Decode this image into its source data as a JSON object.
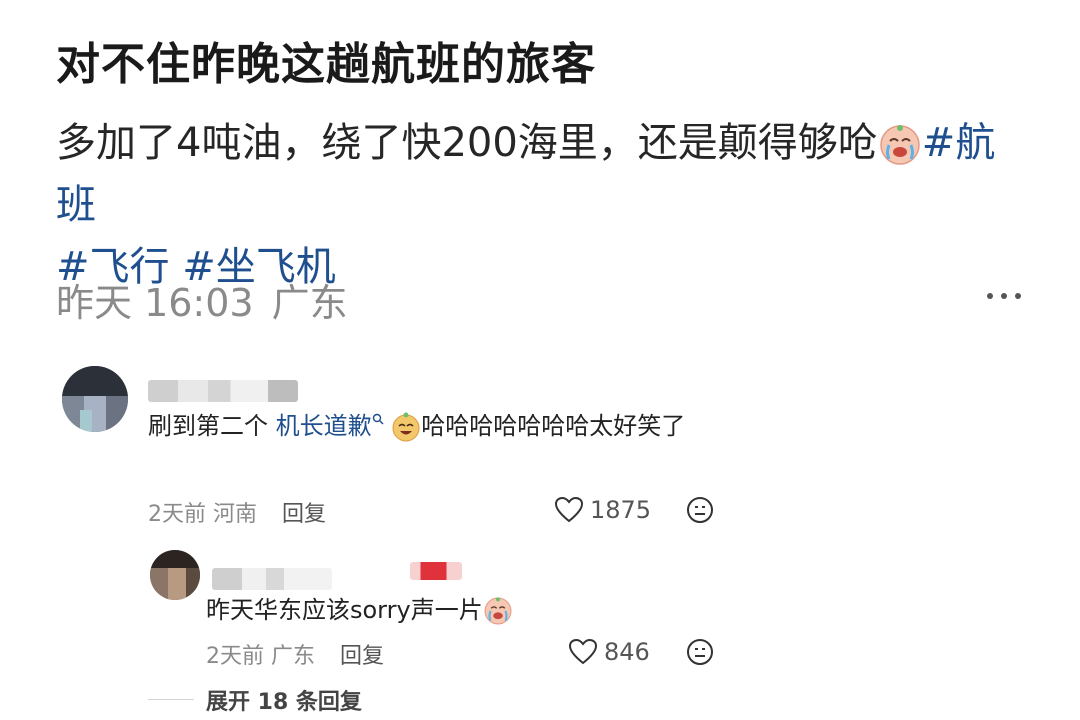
{
  "post": {
    "title": "对不住昨晚这趟航班的旅客",
    "body_text": "多加了4吨油，绕了快200海里，还是颠得够呛",
    "tags": [
      "#航班",
      "#飞行",
      "#坐飞机"
    ],
    "date": "昨天 16:03",
    "location": "广东",
    "more_icon": "more-horizontal-icon"
  },
  "comments": [
    {
      "text_prefix": "刷到第二个",
      "link_text": "机长道歉",
      "text_suffix": "哈哈哈哈哈哈哈太好笑了",
      "time": "2天前",
      "location": "河南",
      "reply_label": "回复",
      "likes": "1875"
    },
    {
      "text": "昨天华东应该sorry声一片",
      "time": "2天前",
      "location": "广东",
      "reply_label": "回复",
      "likes": "846"
    }
  ],
  "expand_label": "展开 18 条回复",
  "colors": {
    "tag": "#1f4f8f",
    "meta": "#8a8a8a",
    "title": "#1a1a1a"
  }
}
